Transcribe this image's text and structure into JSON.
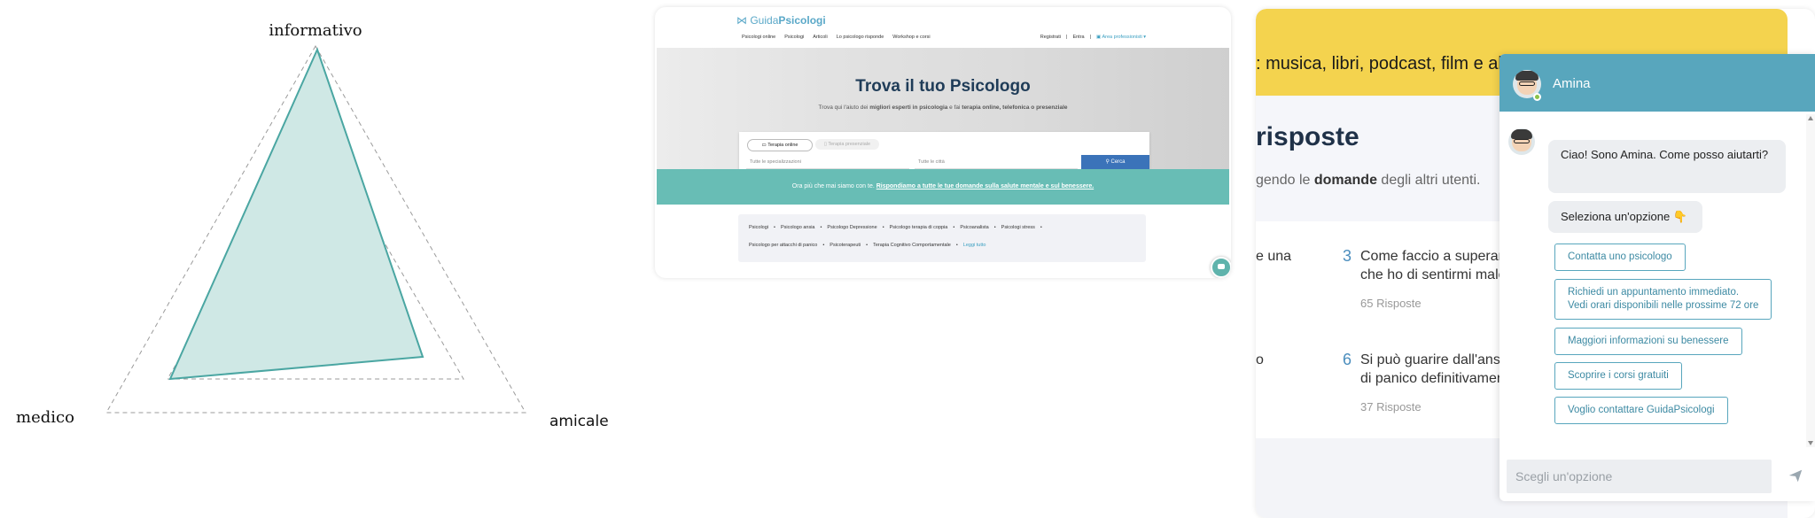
{
  "radar": {
    "axis_top": "informativo",
    "axis_left": "medico",
    "axis_right": "amicale",
    "colors": {
      "fill": "#cfe8e5",
      "stroke": "#4aa6a2",
      "grid": "#9b9b9b"
    }
  },
  "site": {
    "logo_a": "Guida",
    "logo_b": "Psicologi",
    "nav": [
      "Psicologi online",
      "Psicologi",
      "Articoli",
      "Lo psicologo risponde",
      "Workshop e corsi"
    ],
    "nav_right": [
      "Registrati",
      "Entra",
      "Area professionisti"
    ],
    "hero_title": "Trova il tuo Psicologo",
    "hero_sub_a": "Trova qui l'aiuto dei ",
    "hero_sub_b": "migliori esperti in psicologia",
    "hero_sub_c": " e fai ",
    "hero_sub_d": "terapia online, telefonica o presenziale",
    "tab_online": "Terapia online",
    "tab_presenza": "Terapia presenziale",
    "input_specialization": "Tutte le specializzazioni",
    "input_city": "Tutte le città",
    "search_button": "Cerca",
    "banner_a": "Ora più che mai siamo con te. ",
    "banner_b": "Rispondiamo a tutte le tue domande sulla salute mentale e sul benessere.",
    "links_row1": [
      "Psicologi",
      "•",
      "Psicologo ansia",
      "•",
      "Psicologo Depressione",
      "•",
      "Psicologo terapia di coppia",
      "•",
      "Psicoanalista",
      "•",
      "Psicologi stress",
      "•"
    ],
    "links_row2": [
      "Psicologo per attacchi di panico",
      "•",
      "Psicoterapeuti",
      "•",
      "Terapia Cognitivo Comportamentale",
      "•"
    ],
    "links_all": "Leggi tutto",
    "accent": "#68bdb5"
  },
  "chat_page": {
    "yellow_text": ": musica, libri, podcast, film e al",
    "heading": "risposte",
    "sub_a": "gendo le ",
    "sub_b": "domande",
    "sub_c": " degli altri utenti.",
    "left_frag_1": "e una",
    "left_frag_2": "o",
    "q1_num": "3",
    "q1_line1": "Come faccio a superare",
    "q1_line2": "che ho di sentirmi male",
    "q1_answers": "65 Risposte",
    "q2_num": "6",
    "q2_line1": "Si può guarire dall'ansia",
    "q2_line2": "di panico definitivamen",
    "q2_answers": "37 Risposte"
  },
  "widget": {
    "name": "Amina",
    "greeting": "Ciao! Sono Amina. Come posso aiutarti?",
    "prompt": "Seleziona un'opzione 👇",
    "options": [
      "Contatta uno psicologo",
      "Richiedi un appuntamento immediato.",
      "Vedi orari disponibili nelle prossime 72 ore",
      "Maggiori informazioni su benessere",
      "Scoprire i corsi gratuiti",
      "Voglio contattare GuidaPsicologi"
    ],
    "input_placeholder": "Scegli un'opzione",
    "header_color": "#58a6bd"
  }
}
